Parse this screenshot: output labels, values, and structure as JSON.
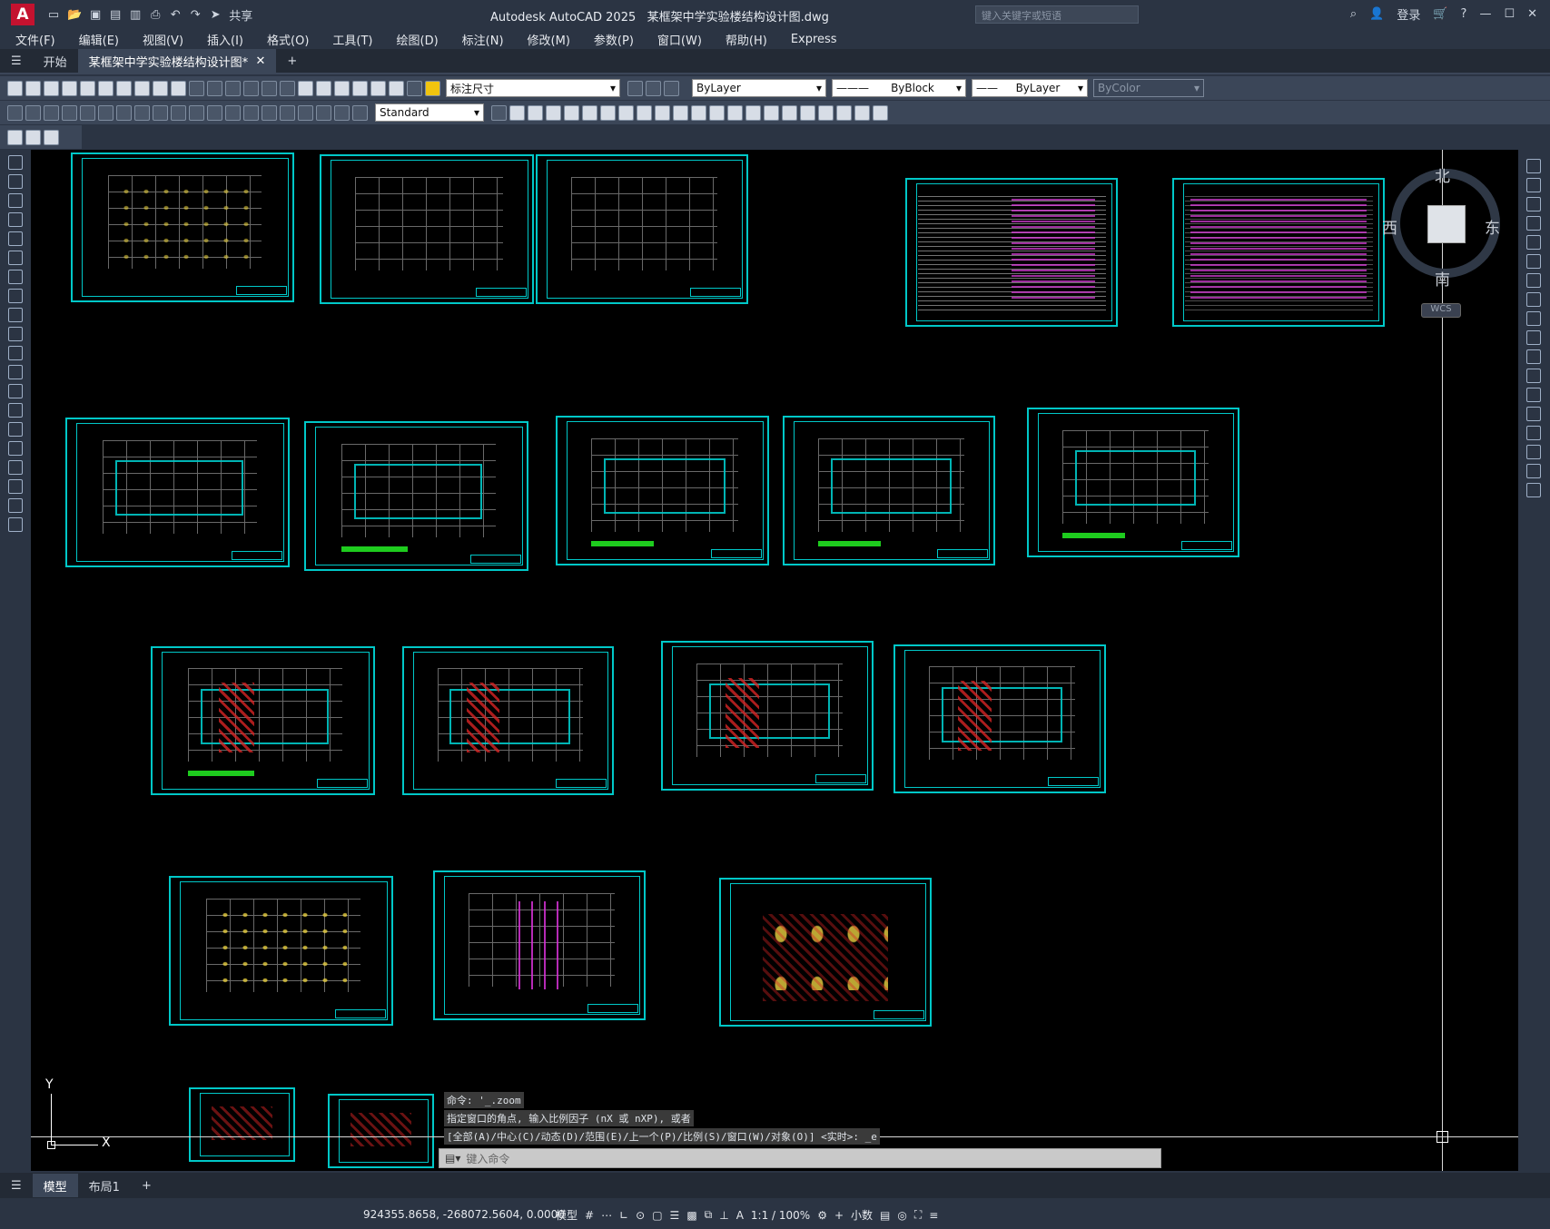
{
  "titlebar": {
    "app_title": "Autodesk AutoCAD 2025",
    "doc_title": "某框架中学实验楼结构设计图.dwg",
    "share": "共享",
    "search_placeholder": "键入关键字或短语",
    "login": "登录"
  },
  "menubar": [
    "文件(F)",
    "编辑(E)",
    "视图(V)",
    "插入(I)",
    "格式(O)",
    "工具(T)",
    "绘图(D)",
    "标注(N)",
    "修改(M)",
    "参数(P)",
    "窗口(W)",
    "帮助(H)",
    "Express"
  ],
  "tabs": {
    "start": "开始",
    "doc": "某框架中学实验楼结构设计图*"
  },
  "toolbar": {
    "dim_style": "标注尺寸",
    "layer_color": "ByLayer",
    "linetype": "ByBlock",
    "lineweight": "ByLayer",
    "plot_color": "ByColor",
    "text_style": "Standard"
  },
  "viewcube": {
    "north": "北",
    "south": "南",
    "east": "东",
    "west": "西",
    "wcs": "WCS"
  },
  "ucs": {
    "x": "X",
    "y": "Y"
  },
  "command": {
    "line1": "命令: '_.zoom",
    "line2": "指定窗口的角点, 输入比例因子 (nX 或 nXP), 或者",
    "line3": "[全部(A)/中心(C)/动态(D)/范围(E)/上一个(P)/比例(S)/窗口(W)/对象(O)] <实时>: _e",
    "placeholder": "键入命令"
  },
  "layout_tabs": {
    "model": "模型",
    "layout1": "布局1"
  },
  "status": {
    "coords": "924355.8658, -268072.5604, 0.0000",
    "model": "模型",
    "scale": "1:1 / 100%",
    "units": "小数"
  }
}
